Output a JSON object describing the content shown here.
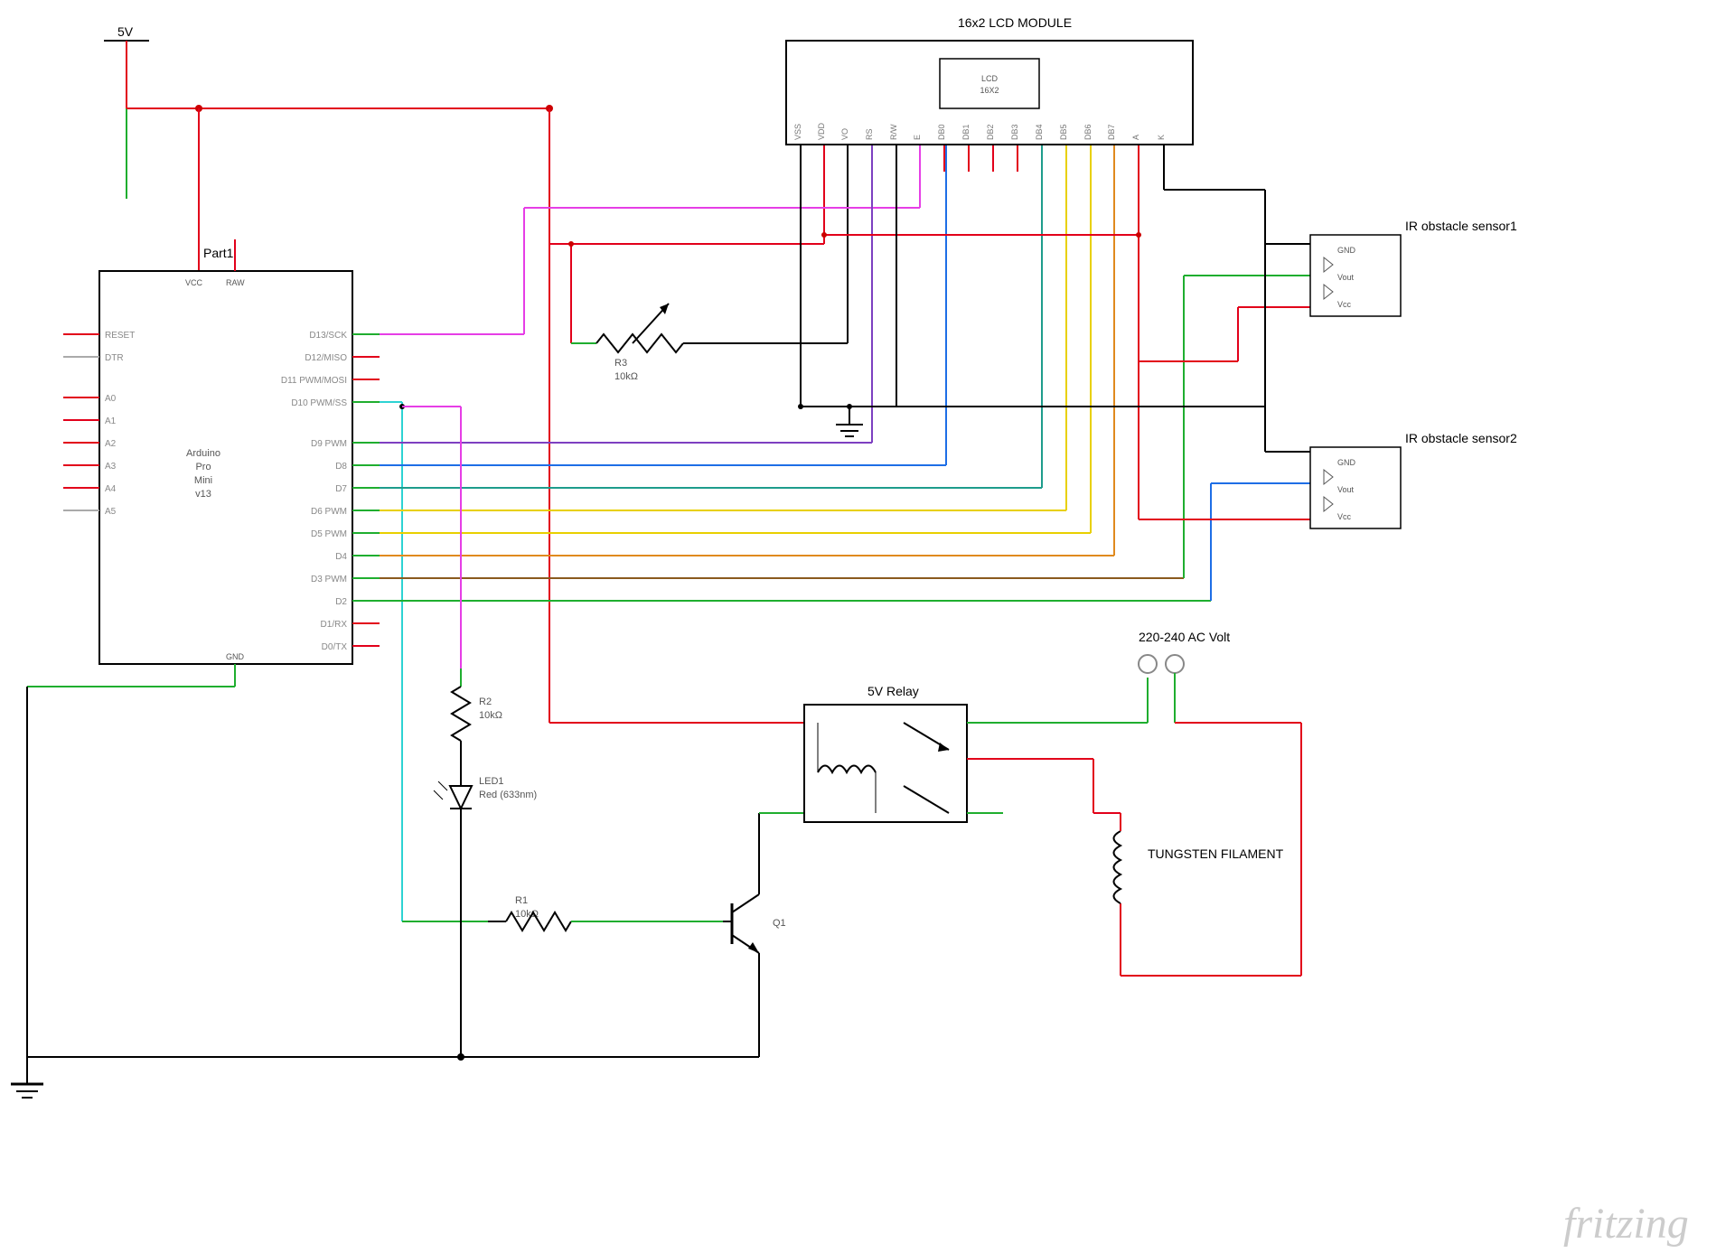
{
  "power_label": "5V",
  "arduino": {
    "part_label": "Part1",
    "chip_line1": "Arduino",
    "chip_line2": "Pro",
    "chip_line3": "Mini",
    "chip_line4": "v13",
    "pins_left": [
      "RESET",
      "DTR",
      "A0",
      "A1",
      "A2",
      "A3",
      "A4",
      "A5"
    ],
    "pins_right": [
      "D13/SCK",
      "D12/MISO",
      "D11 PWM/MOSI",
      "D10 PWM/SS",
      "D9 PWM",
      "D8",
      "D7",
      "D6 PWM",
      "D5 PWM",
      "D4",
      "D3 PWM",
      "D2",
      "D1/RX",
      "D0/TX"
    ],
    "vcc": "VCC",
    "raw": "RAW",
    "gnd": "GND"
  },
  "lcd": {
    "title": "16x2 LCD MODULE",
    "inner1": "LCD",
    "inner2": "16X2",
    "pins": [
      "VSS",
      "VDD",
      "VO",
      "RS",
      "R/W",
      "E",
      "DB0",
      "DB1",
      "DB2",
      "DB3",
      "DB4",
      "DB5",
      "DB6",
      "DB7",
      "A",
      "K"
    ]
  },
  "sensor1": {
    "title": "IR obstacle sensor1",
    "gnd": "GND",
    "vout": "Vout",
    "vcc": "Vcc"
  },
  "sensor2": {
    "title": "IR obstacle sensor2",
    "gnd": "GND",
    "vout": "Vout",
    "vcc": "Vcc"
  },
  "r1": {
    "name": "R1",
    "value": "10kΩ"
  },
  "r2": {
    "name": "R2",
    "value": "10kΩ"
  },
  "r3": {
    "name": "R3",
    "value": "10kΩ"
  },
  "led": {
    "name": "LED1",
    "desc": "Red (633nm)"
  },
  "q1": "Q1",
  "relay": "5V Relay",
  "ac": "220-240 AC Volt",
  "filament": "TUNGSTEN FILAMENT",
  "watermark": "fritzing"
}
